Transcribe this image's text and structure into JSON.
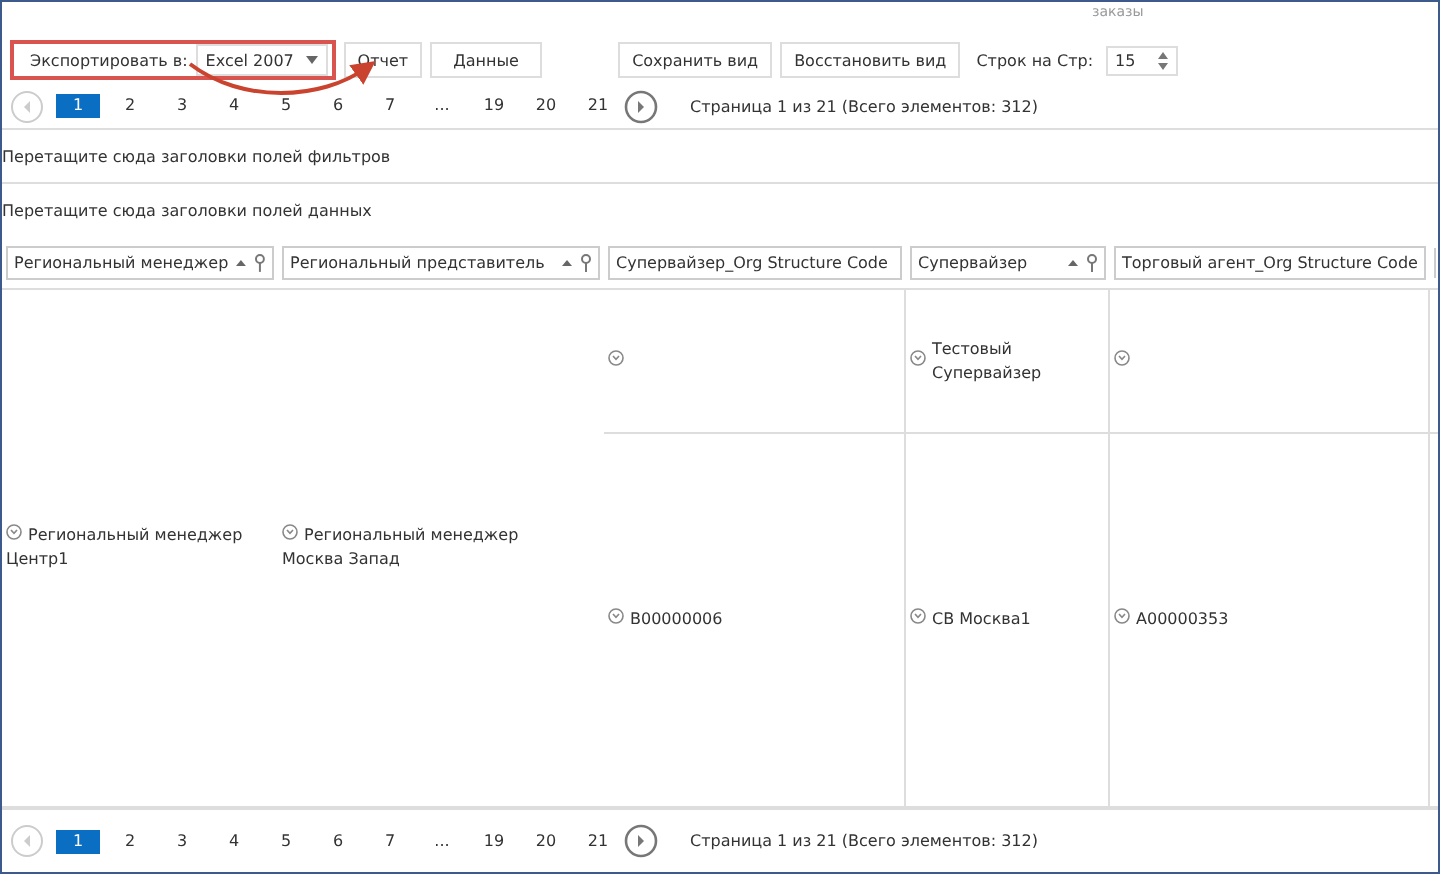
{
  "header_fragment": "заказы",
  "toolbar": {
    "export_label": "Экспортировать в:",
    "export_format": "Excel 2007",
    "buttons": [
      "Отчет",
      "Данные"
    ],
    "view_buttons": [
      "Сохранить вид",
      "Восстановить вид"
    ],
    "rows_label": "Строк на Стр:",
    "rows_value": "15"
  },
  "pager_top": {
    "pages": [
      {
        "label": "1",
        "selected": true
      },
      {
        "label": "2",
        "selected": false
      },
      {
        "label": "3",
        "selected": false
      },
      {
        "label": "4",
        "selected": false
      },
      {
        "label": "5",
        "selected": false
      },
      {
        "label": "6",
        "selected": false
      },
      {
        "label": "7",
        "selected": false
      },
      {
        "label": "...",
        "selected": false
      },
      {
        "label": "19",
        "selected": false
      },
      {
        "label": "20",
        "selected": false
      },
      {
        "label": "21",
        "selected": false
      }
    ],
    "summary": "Страница 1 из 21 (Всего элементов: 312)"
  },
  "filter_area": "Перетащите сюда заголовки полей фильтров",
  "data_area": "Перетащите сюда заголовки полей данных",
  "table": {
    "columns": [
      "Региональный менеджер",
      "Региональный представитель",
      "Супервайзер_Org Structure Code",
      "Супервайзер",
      "Торговый агент_Org Structure Code"
    ],
    "groups": [
      {
        "regional_manager": "Региональный менеджер Центр1",
        "regional_rep": "Региональный менеджер Москва Запад",
        "rows": [
          [
            "",
            "Тестовый Супервайзер",
            ""
          ],
          [
            "B00000006",
            "СВ Москва1",
            "A00000353"
          ]
        ]
      }
    ]
  },
  "pager_bottom": {
    "pages": [
      {
        "label": "1",
        "selected": true
      },
      {
        "label": "2",
        "selected": false
      },
      {
        "label": "3",
        "selected": false
      },
      {
        "label": "4",
        "selected": false
      },
      {
        "label": "5",
        "selected": false
      },
      {
        "label": "6",
        "selected": false
      },
      {
        "label": "7",
        "selected": false
      },
      {
        "label": "...",
        "selected": false
      },
      {
        "label": "19",
        "selected": false
      },
      {
        "label": "20",
        "selected": false
      },
      {
        "label": "21",
        "selected": false
      }
    ],
    "summary": "Страница 1 из 21 (Всего элементов: 312)"
  }
}
